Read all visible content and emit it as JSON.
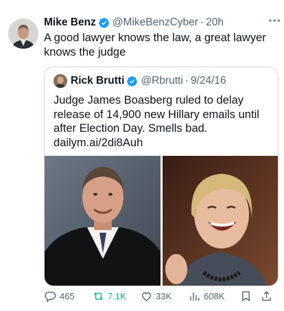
{
  "tweet": {
    "author_name": "Mike Benz",
    "handle": "@MikeBenzCyber",
    "time": "20h",
    "text": "A good lawyer knows the law, a great lawyer knows the judge"
  },
  "quote": {
    "author_name": "Rick Brutti",
    "handle": "@Rbrutti",
    "time": "9/24/16",
    "text": "Judge James Boasberg ruled to delay release of 14,900 new Hillary emails until after Election Day. Smells bad. dailym.ai/2di8Auh"
  },
  "actions": {
    "replies": "465",
    "retweets": "7.1K",
    "likes": "33K",
    "views": "608K"
  },
  "icons": {
    "verified": "verified-badge-icon",
    "more": "more-icon",
    "reply": "reply-icon",
    "retweet": "retweet-icon",
    "like": "heart-icon",
    "views": "views-icon",
    "bookmark": "bookmark-icon",
    "share": "share-icon"
  },
  "colors": {
    "verified": "#1d9bf0",
    "retweet_active": "#00ba7c",
    "secondary_text": "#536471",
    "border": "#cfd9de"
  }
}
